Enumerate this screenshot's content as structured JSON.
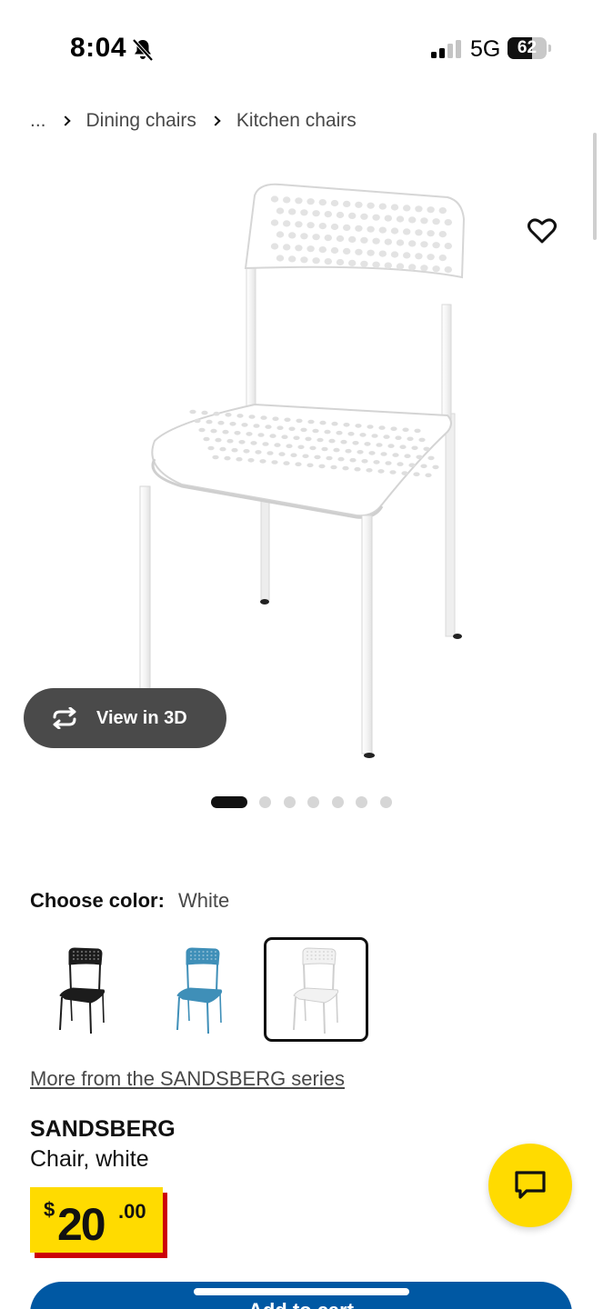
{
  "status_bar": {
    "time": "8:04",
    "network": "5G",
    "battery": "62",
    "battery_level": 0.62
  },
  "breadcrumb": {
    "ellipsis": "...",
    "items": [
      "Dining chairs",
      "Kitchen chairs"
    ]
  },
  "gallery": {
    "view_3d_label": "View in 3D",
    "image_count": 7,
    "active_index": 0
  },
  "color_picker": {
    "label": "Choose color:",
    "selected": "White",
    "options": [
      {
        "name": "Black",
        "color": "#1c1c1c"
      },
      {
        "name": "Blue",
        "color": "#3f8fb8"
      },
      {
        "name": "White",
        "color": "#f2f2f2"
      }
    ]
  },
  "series_link": "More from the SANDSBERG series",
  "product": {
    "name": "SANDSBERG",
    "description": "Chair, white",
    "price": {
      "currency": "$",
      "integer": "20",
      "decimal": ".00"
    }
  },
  "cart_button_label": "Add to cart",
  "colors": {
    "ikea_yellow": "#ffdb00",
    "ikea_blue": "#0058a3",
    "price_red": "#cc0008",
    "button_dark": "#4a4a4a"
  },
  "icons": [
    "bell-slash-icon",
    "signal-icon",
    "battery-icon",
    "chevron-right-icon",
    "heart-icon",
    "rotate-3d-icon",
    "chat-icon"
  ]
}
